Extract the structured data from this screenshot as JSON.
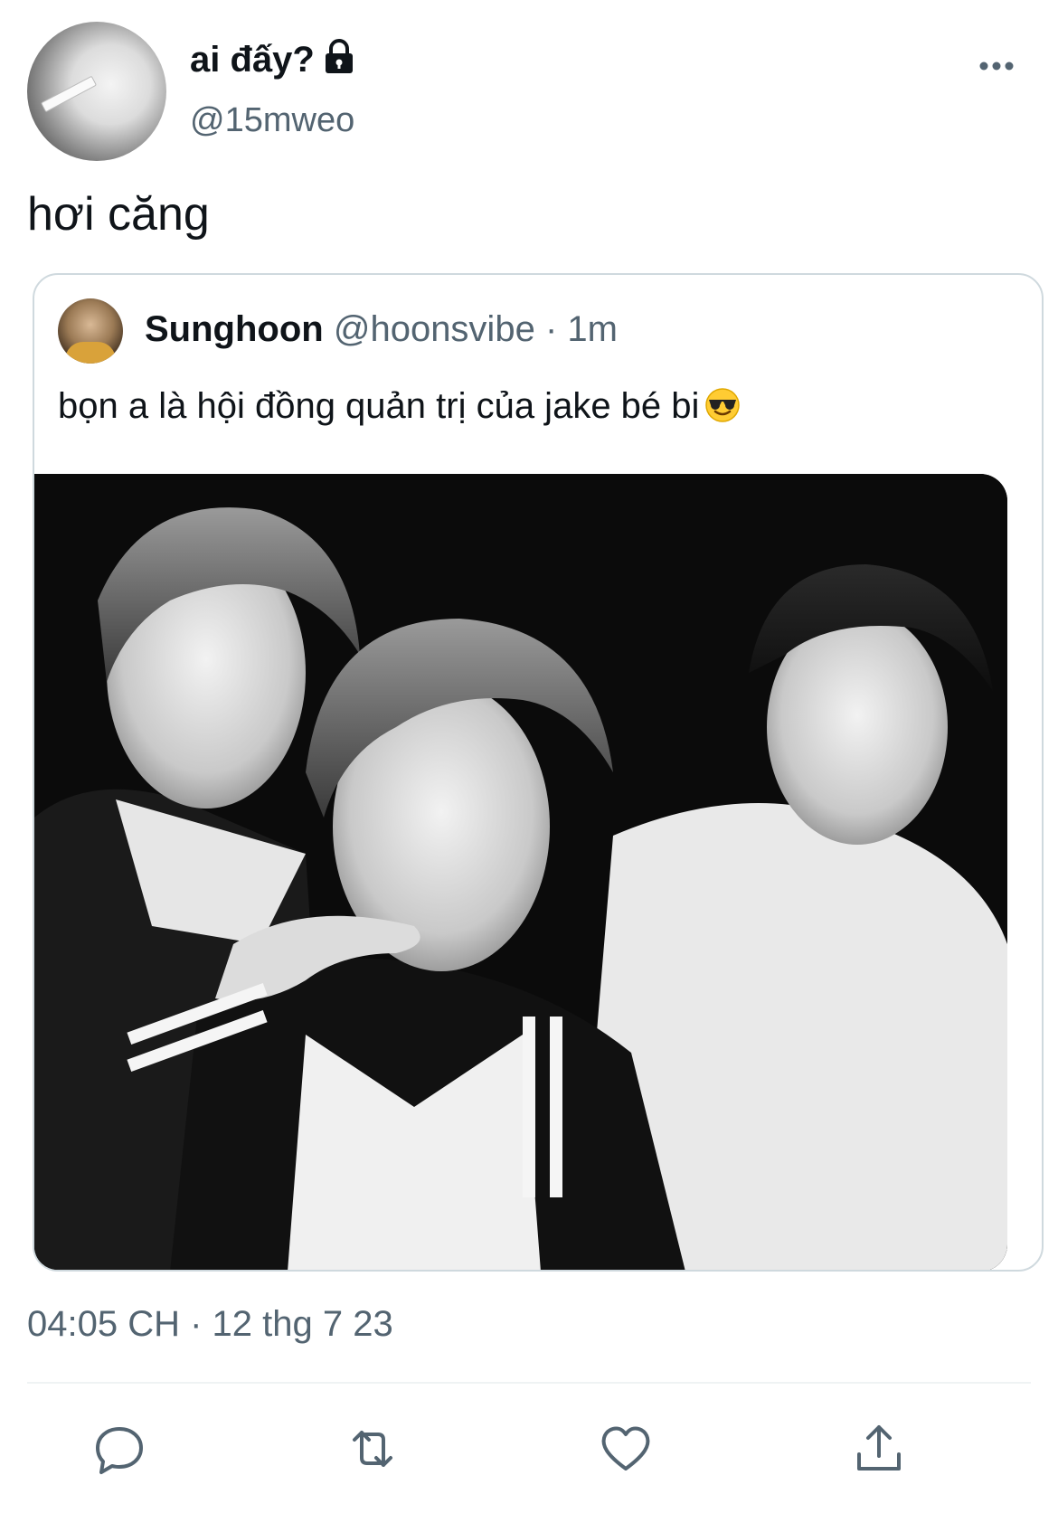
{
  "tweet": {
    "display_name": "ai đấy?",
    "handle": "@15mweo",
    "text": "hơi căng",
    "timestamp": "04:05 CH · 12 thg 7 23"
  },
  "quote": {
    "display_name": "Sunghoon",
    "handle": "@hoonsvibe",
    "separator": "·",
    "time": "1m",
    "text": "bọn a là hội đồng quản trị của jake bé bi"
  },
  "icons": {
    "lock": "lock-icon",
    "more": "more-horizontal-icon",
    "reply": "reply-icon",
    "retweet": "retweet-icon",
    "like": "heart-icon",
    "share": "share-icon",
    "emoji": "smiling-face-with-sunglasses-emoji"
  },
  "colors": {
    "text_primary": "#0f1419",
    "text_secondary": "#536471",
    "border": "#cfd9de"
  }
}
